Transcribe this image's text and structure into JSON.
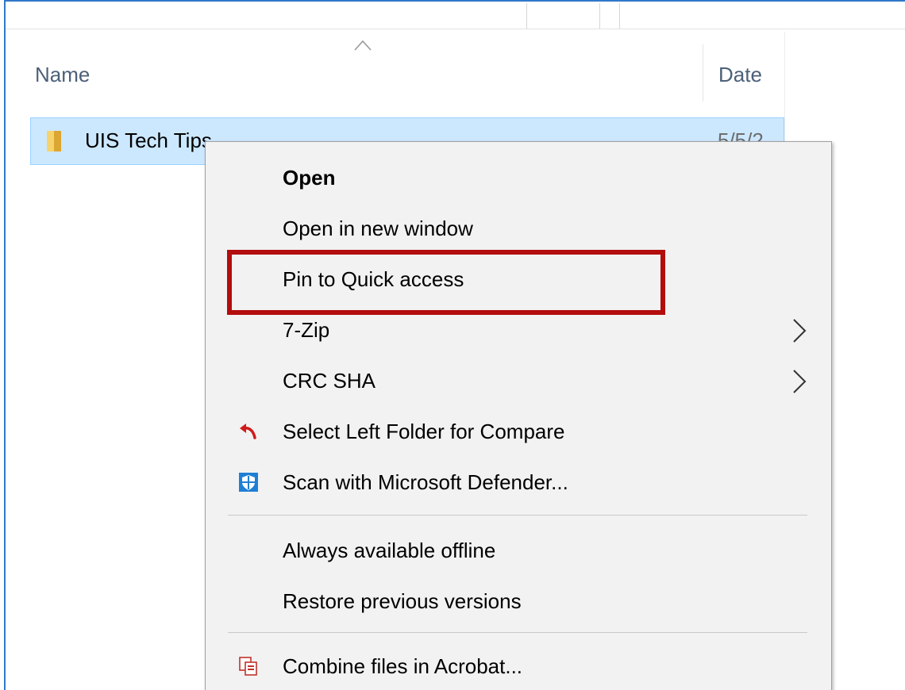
{
  "explorer": {
    "columns": {
      "name": "Name",
      "date": "Date"
    },
    "selected_row": {
      "name": "UIS Tech Tips",
      "date": "5/5/2"
    }
  },
  "context_menu": {
    "items": [
      {
        "label": "Open",
        "bold": true,
        "icon": null,
        "submenu": false
      },
      {
        "label": "Open in new window",
        "icon": null,
        "submenu": false
      },
      {
        "label": "Pin to Quick access",
        "icon": null,
        "submenu": false,
        "highlighted": true
      },
      {
        "label": "7-Zip",
        "icon": null,
        "submenu": true
      },
      {
        "label": "CRC SHA",
        "icon": null,
        "submenu": true
      },
      {
        "label": "Select Left Folder for Compare",
        "icon": "compare-arrow-icon",
        "submenu": false
      },
      {
        "label": "Scan with Microsoft Defender...",
        "icon": "defender-shield-icon",
        "submenu": false
      },
      {
        "label": "Always available offline",
        "icon": null,
        "submenu": false
      },
      {
        "label": "Restore previous versions",
        "icon": null,
        "submenu": false
      },
      {
        "label": "Combine files in Acrobat...",
        "icon": "acrobat-combine-icon",
        "submenu": false
      }
    ]
  },
  "colors": {
    "selection_bg": "#cce8ff",
    "selection_border": "#99d1ff",
    "menu_bg": "#f2f2f2",
    "highlight_box": "#b30d0d",
    "window_border": "#2f78c8",
    "header_text": "#4c607a"
  }
}
